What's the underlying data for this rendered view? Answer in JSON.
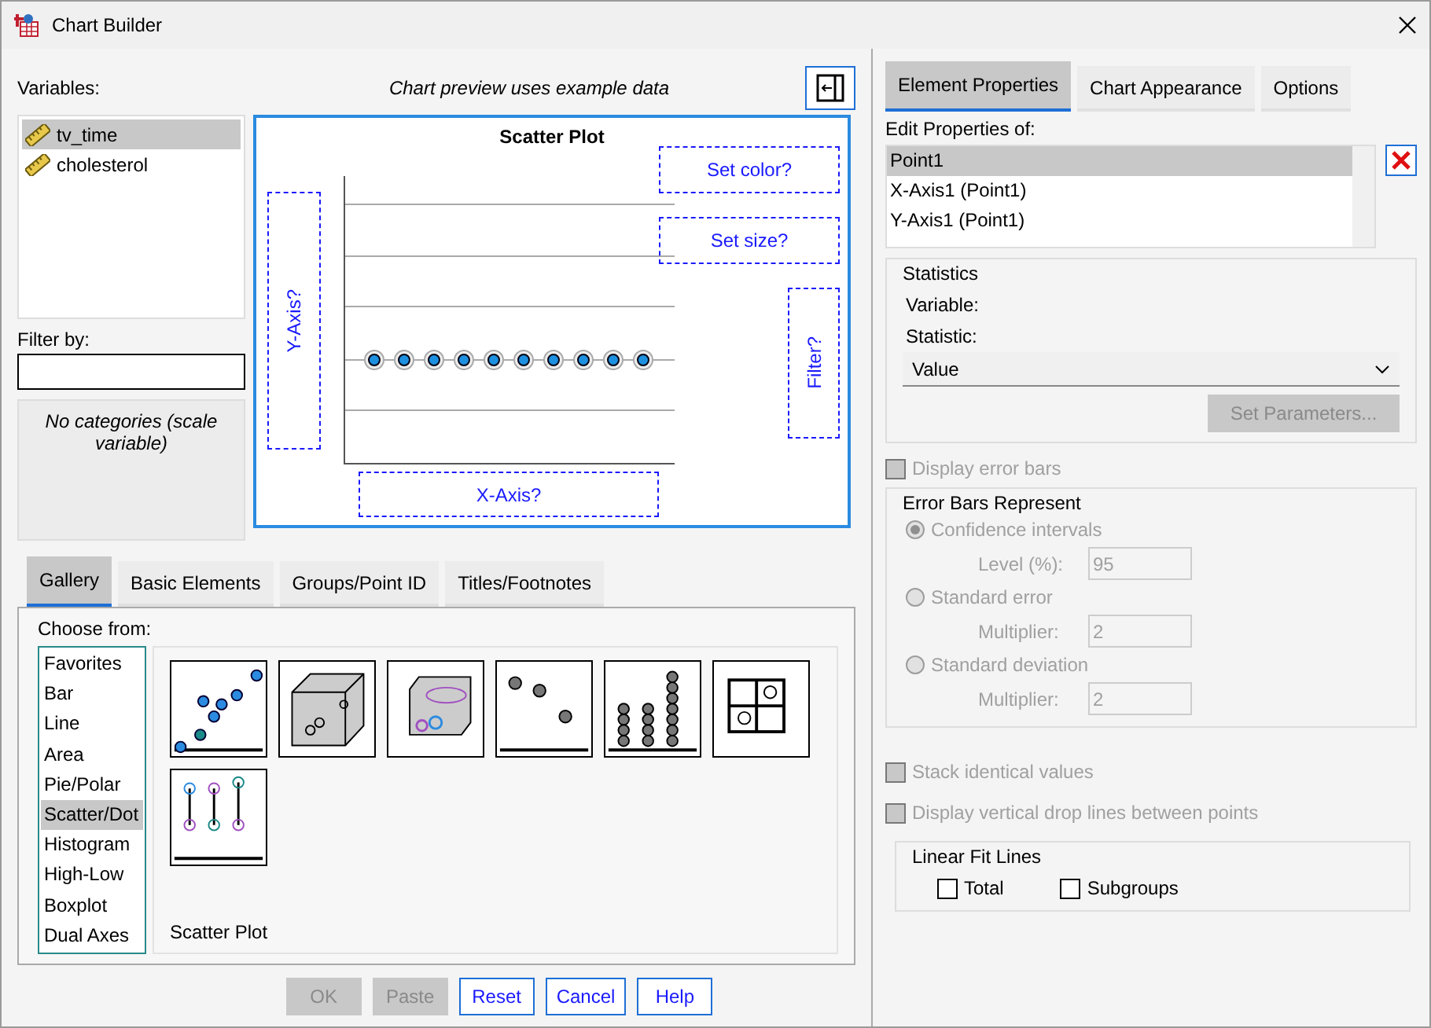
{
  "window": {
    "title": "Chart Builder"
  },
  "variables": {
    "label": "Variables:",
    "items": [
      {
        "name": "tv_time",
        "selected": true
      },
      {
        "name": "cholesterol",
        "selected": false
      }
    ]
  },
  "filter": {
    "label": "Filter by:"
  },
  "categories_note": "No categories (scale variable)",
  "preview": {
    "note": "Chart preview uses example data",
    "title": "Scatter Plot",
    "drop_zones": [
      {
        "kind": "color",
        "label": "Set color?"
      },
      {
        "kind": "size",
        "label": "Set size?"
      },
      {
        "kind": "filter",
        "label": "Filter?"
      },
      {
        "kind": "y",
        "label": "Y-Axis?"
      },
      {
        "kind": "x",
        "label": "X-Axis?"
      }
    ]
  },
  "gallery": {
    "tabs": [
      {
        "label": "Gallery",
        "selected": true
      },
      {
        "label": "Basic Elements",
        "selected": false
      },
      {
        "label": "Groups/Point ID",
        "selected": false
      },
      {
        "label": "Titles/Footnotes",
        "selected": false
      }
    ],
    "choose_label": "Choose from:",
    "types": [
      {
        "label": "Favorites",
        "selected": false
      },
      {
        "label": "Bar",
        "selected": false
      },
      {
        "label": "Line",
        "selected": false
      },
      {
        "label": "Area",
        "selected": false
      },
      {
        "label": "Pie/Polar",
        "selected": false
      },
      {
        "label": "Scatter/Dot",
        "selected": true
      },
      {
        "label": "Histogram",
        "selected": false
      },
      {
        "label": "High-Low",
        "selected": false
      },
      {
        "label": "Boxplot",
        "selected": false
      },
      {
        "label": "Dual Axes",
        "selected": false
      }
    ],
    "caption": "Scatter Plot"
  },
  "buttons": [
    {
      "label": "OK",
      "disabled": true
    },
    {
      "label": "Paste",
      "disabled": true
    },
    {
      "label": "Reset",
      "disabled": false
    },
    {
      "label": "Cancel",
      "disabled": false
    },
    {
      "label": "Help",
      "disabled": false
    }
  ],
  "properties": {
    "tabs": [
      {
        "label": "Element Properties",
        "selected": true
      },
      {
        "label": "Chart Appearance",
        "selected": false
      },
      {
        "label": "Options",
        "selected": false
      }
    ],
    "edit_label": "Edit Properties of:",
    "elements": [
      {
        "label": "Point1",
        "selected": true
      },
      {
        "label": "X-Axis1 (Point1)",
        "selected": false
      },
      {
        "label": "Y-Axis1 (Point1)",
        "selected": false
      }
    ],
    "statistics": {
      "title": "Statistics",
      "variable_label": "Variable:",
      "statistic_label": "Statistic:",
      "statistic_value": "Value",
      "set_parameters": {
        "label": "Set Parameters...",
        "disabled": true
      }
    },
    "display_error_bars": {
      "label": "Display error bars",
      "checked": false,
      "disabled": true
    },
    "error_bars": {
      "title": "Error Bars Represent",
      "disabled": true,
      "options": [
        {
          "label": "Confidence intervals",
          "selected": true,
          "field_label": "Level (%):",
          "field_value": "95"
        },
        {
          "label": "Standard error",
          "selected": false,
          "field_label": "Multiplier:",
          "field_value": "2"
        },
        {
          "label": "Standard deviation",
          "selected": false,
          "field_label": "Multiplier:",
          "field_value": "2"
        }
      ]
    },
    "stack_identical": {
      "label": "Stack identical values",
      "checked": false,
      "disabled": true
    },
    "drop_lines": {
      "label": "Display vertical drop lines between points",
      "checked": false,
      "disabled": true
    },
    "fit_lines": {
      "title": "Linear Fit Lines",
      "options": [
        {
          "label": "Total",
          "checked": false
        },
        {
          "label": "Subgroups",
          "checked": false
        }
      ]
    }
  }
}
